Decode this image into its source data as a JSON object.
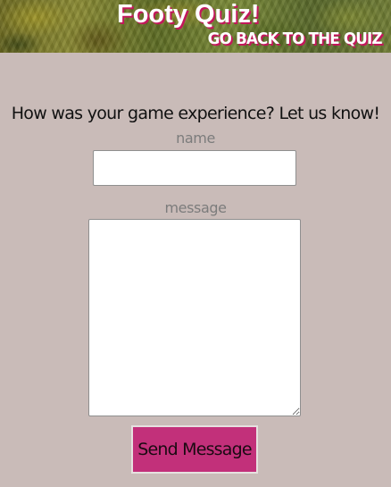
{
  "header": {
    "title": "Footy Quiz!",
    "back_link": "GO BACK TO THE QUIZ"
  },
  "feedback": {
    "prompt": "How was your game experience? Let us know!",
    "name_label": "name",
    "name_value": "",
    "message_label": "message",
    "message_value": "",
    "submit_label": "Send Message"
  },
  "colors": {
    "background": "#c9bbb8",
    "accent": "#c2307a",
    "title_shadow": "#c2185b"
  }
}
